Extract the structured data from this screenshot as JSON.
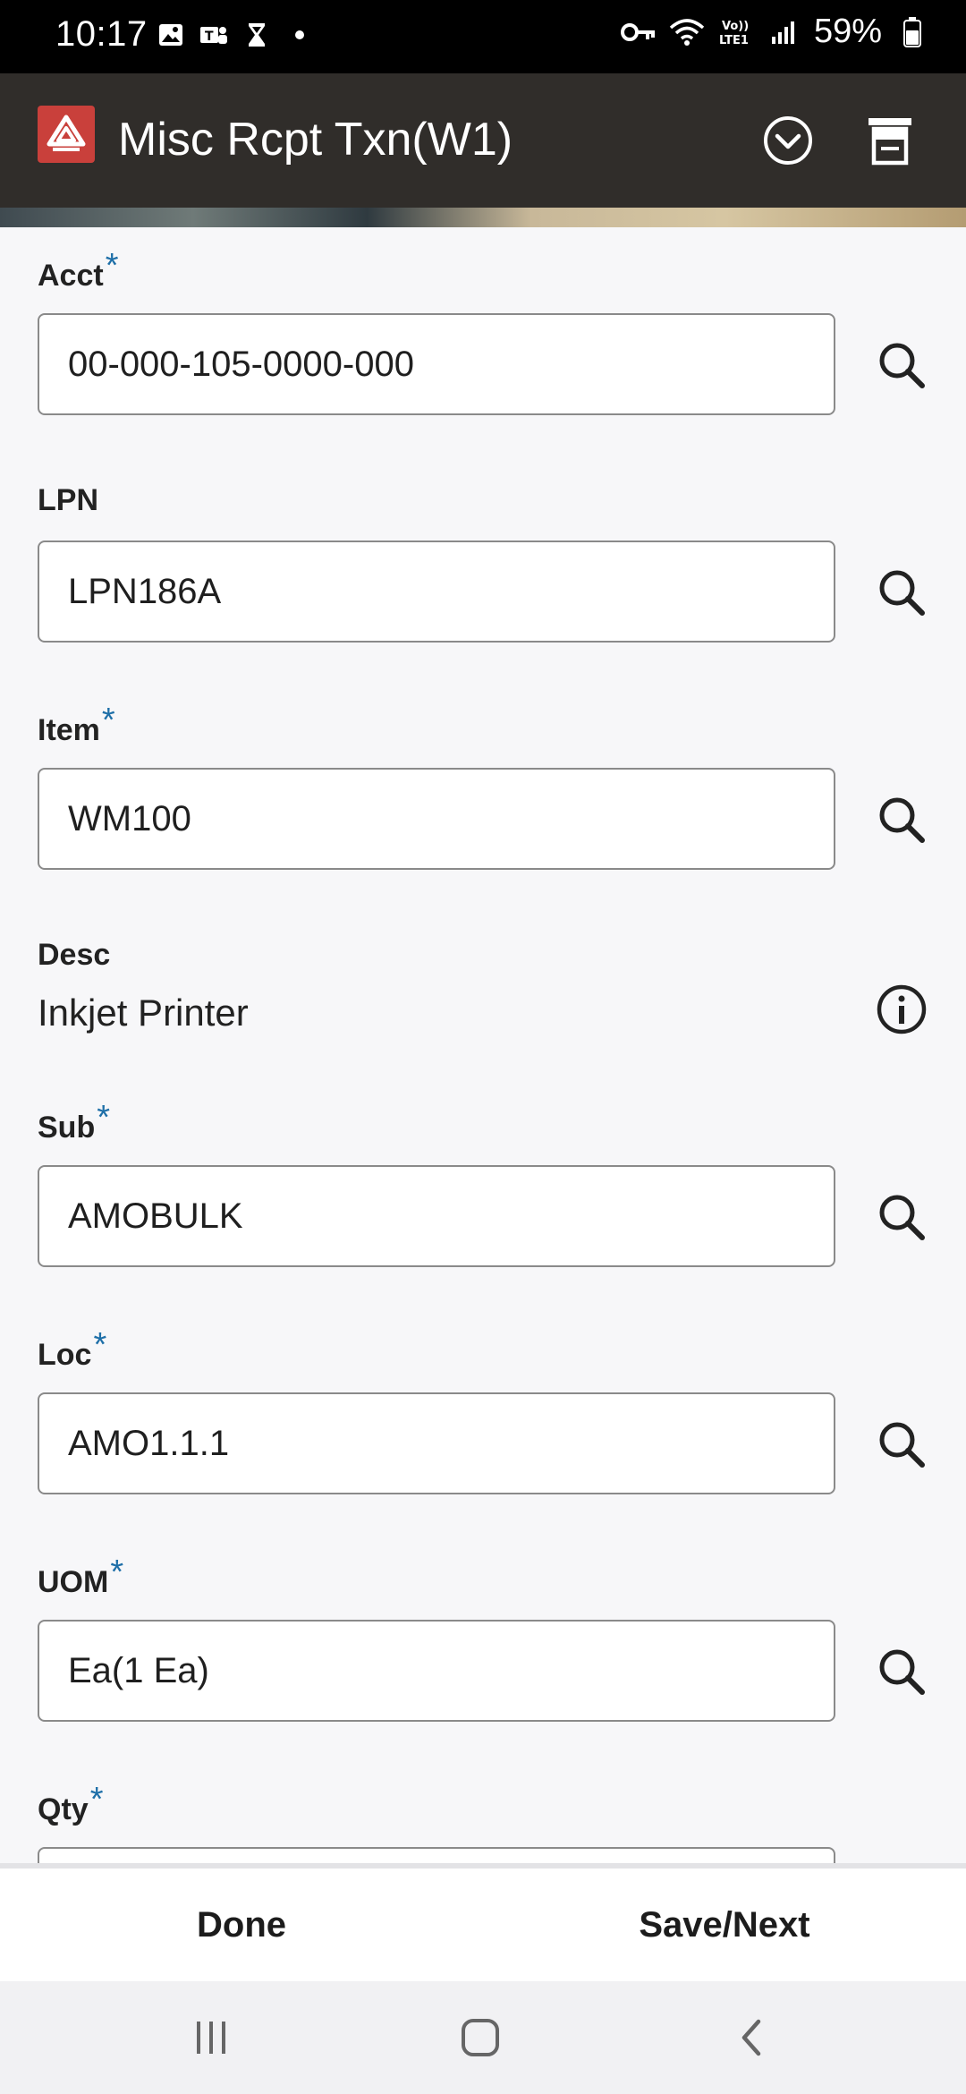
{
  "status_bar": {
    "time": "10:17",
    "battery": "59%",
    "left_icons": [
      "gallery-icon",
      "teams-icon",
      "hourglass-icon",
      "dot-icon"
    ],
    "right_icons": [
      "key-icon",
      "wifi-icon",
      "volte-icon",
      "signal-icon",
      "battery-icon"
    ],
    "volte_text": "Vo)) LTE1"
  },
  "header": {
    "title": "Misc Rcpt Txn(W1)",
    "logo_color": "#c9403b",
    "background": "#302d2a"
  },
  "form": {
    "acct": {
      "label": "Acct",
      "required": "*",
      "value": "00-000-105-0000-000"
    },
    "lpn": {
      "label": "LPN",
      "value": "LPN186A"
    },
    "item": {
      "label": "Item",
      "required": "*",
      "value": "WM100"
    },
    "desc": {
      "label": "Desc",
      "value": "Inkjet Printer"
    },
    "sub": {
      "label": "Sub",
      "required": "*",
      "value": "AMOBULK"
    },
    "loc": {
      "label": "Loc",
      "required": "*",
      "value": "AMO1.1.1"
    },
    "uom": {
      "label": "UOM",
      "required": "*",
      "value": "Ea(1 Ea)"
    },
    "qty": {
      "label": "Qty",
      "required": "*",
      "value": ""
    }
  },
  "actions": {
    "done": "Done",
    "save_next": "Save/Next"
  },
  "accent_color": "#1e6fa8"
}
